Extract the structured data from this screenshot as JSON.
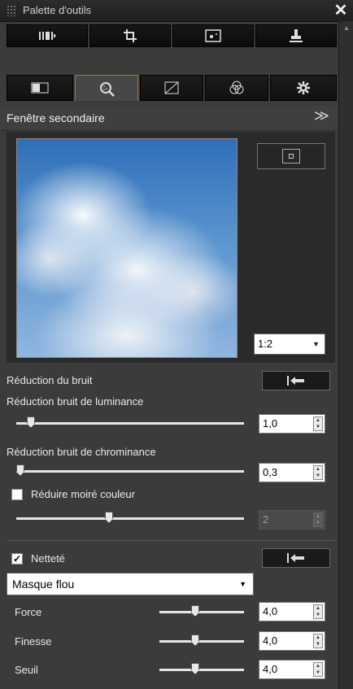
{
  "window": {
    "title": "Palette d'outils"
  },
  "toolbar_icons": [
    "rgb-adjust-icon",
    "crop-icon",
    "dust-removal-icon",
    "stamp-icon"
  ],
  "tabs": [
    {
      "icon": "basic-adjust-icon",
      "active": false
    },
    {
      "icon": "noise-detail-icon",
      "active": true
    },
    {
      "icon": "tone-curve-icon",
      "active": false
    },
    {
      "icon": "color-adjust-icon",
      "active": false
    },
    {
      "icon": "settings-icon",
      "active": false
    }
  ],
  "section": {
    "title": "Fenêtre secondaire"
  },
  "preview": {
    "zoom_value": "1:2"
  },
  "noise": {
    "title": "Réduction du bruit",
    "luminance": {
      "label": "Réduction bruit de luminance",
      "value": "1,0",
      "slider_fraction": 0.07
    },
    "chrominance": {
      "label": "Réduction bruit de chrominance",
      "value": "0,3",
      "slider_fraction": 0.02
    },
    "moire": {
      "label": "Réduire moiré couleur",
      "checked": false,
      "value": "2",
      "slider_fraction": 0.4
    }
  },
  "sharpness": {
    "label": "Netteté",
    "checked": true,
    "mode": "Masque flou",
    "force": {
      "label": "Force",
      "value": "4,0",
      "slider_fraction": 0.4
    },
    "finesse": {
      "label": "Finesse",
      "value": "4,0",
      "slider_fraction": 0.4
    },
    "seuil": {
      "label": "Seuil",
      "value": "4,0",
      "slider_fraction": 0.4
    }
  }
}
